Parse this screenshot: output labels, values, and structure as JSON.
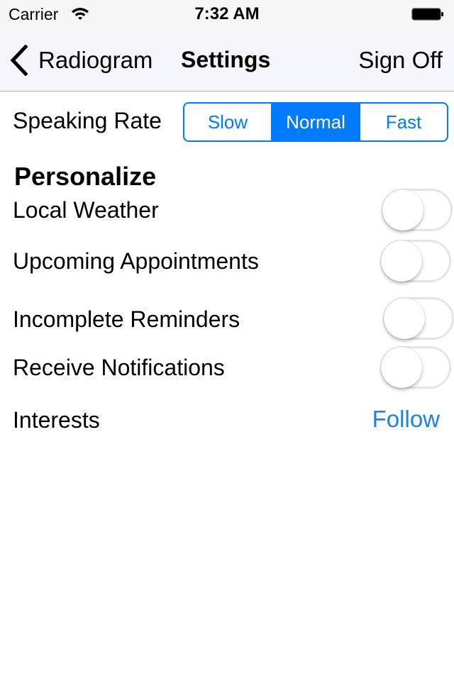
{
  "status_bar": {
    "carrier": "Carrier",
    "time": "7:32 AM",
    "wifi_icon": "wifi-icon",
    "battery_icon": "battery-icon"
  },
  "nav": {
    "back_label": "Radiogram",
    "back_icon": "chevron-left-icon",
    "title": "Settings",
    "right_button": "Sign Off"
  },
  "speaking_rate": {
    "label": "Speaking Rate",
    "options": [
      "Slow",
      "Normal",
      "Fast"
    ],
    "selected": "Normal"
  },
  "personalize": {
    "title": "Personalize",
    "items": [
      {
        "label": "Local Weather",
        "on": false
      },
      {
        "label": "Upcoming Appointments",
        "on": false
      },
      {
        "label": "Incomplete Reminders",
        "on": false
      },
      {
        "label": "Receive Notifications",
        "on": false
      }
    ]
  },
  "interests": {
    "label": "Interests",
    "action": "Follow"
  },
  "colors": {
    "accent": "#007aff",
    "link": "#1a7ff0",
    "toggle_border": "#e5e5e5"
  }
}
